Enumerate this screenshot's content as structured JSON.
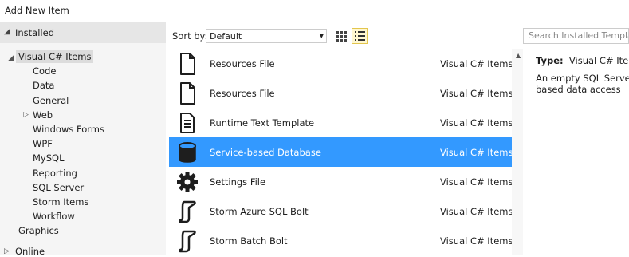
{
  "window": {
    "title": "Add New Item"
  },
  "tree": {
    "installed_label": "Installed",
    "root_label": "Visual C# Items",
    "children": [
      "Code",
      "Data",
      "General",
      "Web",
      "Windows Forms",
      "WPF",
      "MySQL",
      "Reporting",
      "SQL Server",
      "Storm Items",
      "Workflow"
    ],
    "graphics_label": "Graphics",
    "online_label": "Online"
  },
  "toolbar": {
    "sort_label": "Sort by:",
    "sort_value": "Default",
    "view_grid_icon": "grid-view-icon",
    "view_list_icon": "list-view-icon"
  },
  "search": {
    "placeholder": "Search Installed Templat"
  },
  "items": [
    {
      "name": "Resources File",
      "category": "Visual C# Items",
      "icon": "document-icon",
      "selected": false
    },
    {
      "name": "Resources File",
      "category": "Visual C# Items",
      "icon": "document-icon",
      "selected": false
    },
    {
      "name": "Runtime Text Template",
      "category": "Visual C# Items",
      "icon": "text-template-icon",
      "selected": false
    },
    {
      "name": "Service-based Database",
      "category": "Visual C# Items",
      "icon": "database-icon",
      "selected": true
    },
    {
      "name": "Settings File",
      "category": "Visual C# Items",
      "icon": "gear-icon",
      "selected": false
    },
    {
      "name": "Storm Azure SQL Bolt",
      "category": "Visual C# Items",
      "icon": "storm-bolt-icon",
      "selected": false
    },
    {
      "name": "Storm Batch Bolt",
      "category": "Visual C# Items",
      "icon": "storm-bolt-icon",
      "selected": false
    }
  ],
  "details": {
    "type_label": "Type:",
    "type_value": "Visual C# Items",
    "desc_line1": "An empty SQL Server d",
    "desc_line2": "based data access"
  },
  "colors": {
    "selection": "#3399ff",
    "pane_bg": "#f5f5f5",
    "header_bg": "#e6e6e6"
  }
}
